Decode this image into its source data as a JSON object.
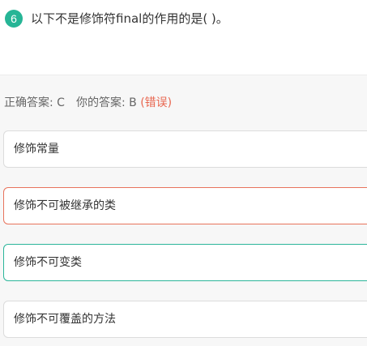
{
  "question": {
    "number": "6",
    "text": "以下不是修饰符final的作用的是( )。"
  },
  "result": {
    "correct_prefix": "正确答案: ",
    "correct_answer": "C",
    "yours_prefix": "你的答案: ",
    "your_answer": "B",
    "status": "(错误)"
  },
  "options": [
    {
      "label": "修饰常量"
    },
    {
      "label": "修饰不可被继承的类"
    },
    {
      "label": "修饰不可变类"
    },
    {
      "label": "修饰不可覆盖的方法"
    }
  ],
  "colors": {
    "accent": "#26b596",
    "wrong": "#e8664f",
    "correct_border": "#2bb59a",
    "wrong_border": "#e8735c"
  }
}
